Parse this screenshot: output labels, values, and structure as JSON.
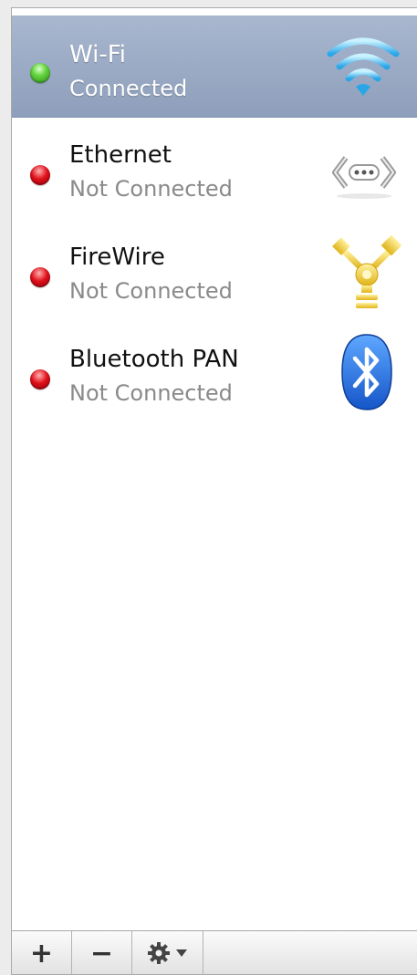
{
  "services": [
    {
      "name": "Wi-Fi",
      "status": "Connected",
      "state": "connected",
      "icon": "wifi-icon",
      "selected": true
    },
    {
      "name": "Ethernet",
      "status": "Not Connected",
      "state": "disconnected",
      "icon": "ethernet-icon",
      "selected": false
    },
    {
      "name": "FireWire",
      "status": "Not Connected",
      "state": "disconnected",
      "icon": "firewire-icon",
      "selected": false
    },
    {
      "name": "Bluetooth PAN",
      "status": "Not Connected",
      "state": "disconnected",
      "icon": "bluetooth-icon",
      "selected": false
    }
  ],
  "toolbar": {
    "add_label": "+",
    "remove_label": "−",
    "action_icon": "gear-icon",
    "menu_icon": "chevron-down-icon"
  },
  "colors": {
    "selection": "#95a6c1",
    "connected": "#3cb521",
    "disconnected": "#d8101a"
  }
}
